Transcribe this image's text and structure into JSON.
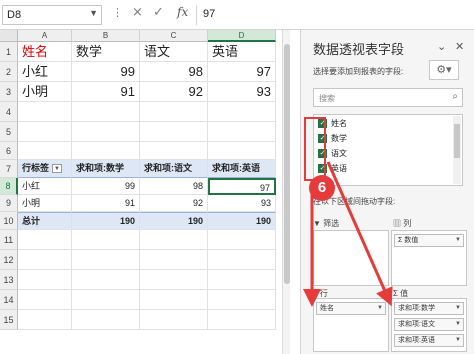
{
  "formula_bar": {
    "name_box": "D8",
    "cancel_icon": "×",
    "enter_icon": "✓",
    "fx_label": "fx",
    "value": "97"
  },
  "columns": [
    "A",
    "B",
    "C",
    "D"
  ],
  "rows": [
    "1",
    "2",
    "3",
    "4",
    "5",
    "6",
    "7",
    "8",
    "9",
    "10",
    "11",
    "12",
    "13",
    "14",
    "15"
  ],
  "source_table": {
    "headers": [
      "姓名",
      "数学",
      "语文",
      "英语"
    ],
    "records": [
      {
        "name": "小红",
        "math": "99",
        "chinese": "98",
        "english": "97"
      },
      {
        "name": "小明",
        "math": "91",
        "chinese": "92",
        "english": "93"
      }
    ]
  },
  "pivot_table": {
    "headers": [
      "行标签",
      "求和项:数学",
      "求和项:语文",
      "求和项:英语"
    ],
    "records": [
      {
        "name": "小红",
        "math": "99",
        "chinese": "98",
        "english": "97"
      },
      {
        "name": "小明",
        "math": "91",
        "chinese": "92",
        "english": "93"
      }
    ],
    "total": {
      "label": "总计",
      "math": "190",
      "chinese": "190",
      "english": "190"
    }
  },
  "pane": {
    "title": "数据透视表字段",
    "subtitle": "选择要添加到报表的字段:",
    "search_placeholder": "搜索",
    "fields": [
      "姓名",
      "数学",
      "语文",
      "英语"
    ],
    "drag_hint": "在以下区域间拖动字段:",
    "filter_label": "筛选",
    "columns_label": "列",
    "columns_chip": "Σ 数值",
    "rows_label": "行",
    "rows_chip": "姓名",
    "values_label": "值",
    "values_chips": [
      "求和项:数学",
      "求和项:语文",
      "求和项:英语"
    ]
  },
  "annotation": {
    "step": "6",
    "color": "#e53b3b"
  },
  "colors": {
    "accent": "#217346",
    "pivot_band": "#dde7f6",
    "annotation": "#e53b3b"
  }
}
